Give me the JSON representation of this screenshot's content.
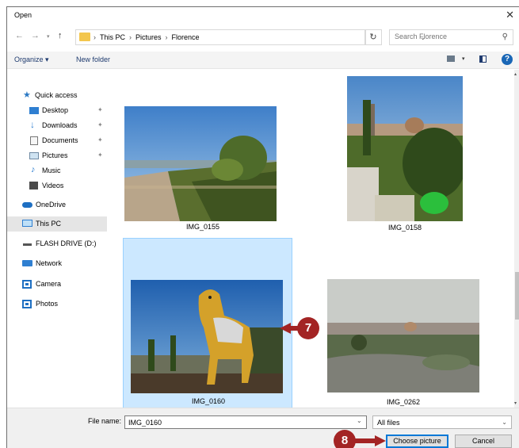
{
  "window": {
    "title": "Open"
  },
  "address": {
    "crumbs": [
      "This PC",
      "Pictures",
      "Florence"
    ],
    "search_placeholder": "Search Florence"
  },
  "toolbar": {
    "organize": "Organize ▾",
    "new_folder": "New folder"
  },
  "sidebar": {
    "quick_access": "Quick access",
    "desktop": "Desktop",
    "downloads": "Downloads",
    "documents": "Documents",
    "pictures": "Pictures",
    "music": "Music",
    "videos": "Videos",
    "onedrive": "OneDrive",
    "this_pc": "This PC",
    "flash_drive": "FLASH DRIVE (D:)",
    "network": "Network",
    "camera": "Camera",
    "photos": "Photos"
  },
  "files": [
    {
      "name": "IMG_0155"
    },
    {
      "name": "IMG_0158"
    },
    {
      "name": "IMG_0160"
    },
    {
      "name": "IMG_0262"
    }
  ],
  "footer": {
    "file_name_label": "File name:",
    "file_name_value": "IMG_0160",
    "file_type": "All files",
    "choose_label": "Choose picture",
    "cancel_label": "Cancel"
  },
  "callouts": {
    "step7": "7",
    "step8": "8"
  },
  "colors": {
    "accent": "#0078d7",
    "callout": "#a32424",
    "selection": "#cce8ff"
  }
}
